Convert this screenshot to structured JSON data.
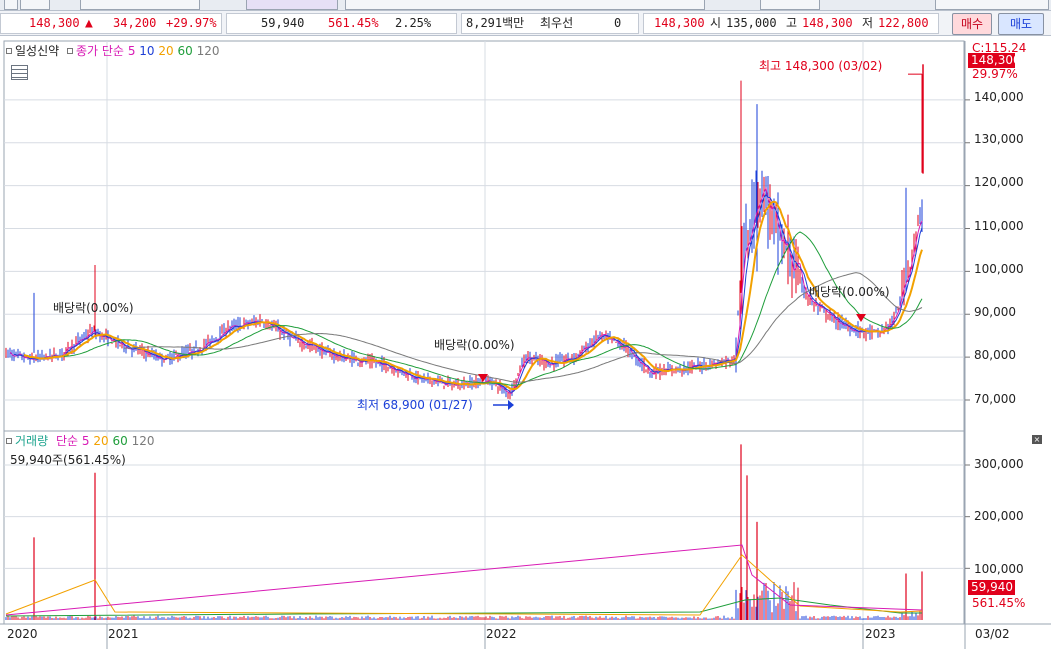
{
  "quote": {
    "price": "148,300",
    "change": "34,200",
    "change_rate": "+29.97%",
    "volume": "59,940",
    "volume_ratio": "561.45%",
    "turnover": "2.25%",
    "amount": "8,291백만",
    "best_label": "최우선",
    "best_qty": "0",
    "best_price": "148,300",
    "open_label": "시",
    "open": "135,000",
    "high_label": "고",
    "high": "148,300",
    "low_label": "저",
    "low": "122,800",
    "buy_label": "매수",
    "sell_label": "매도"
  },
  "price_panel": {
    "item_label": "일성신약",
    "ma_label": "종가 단순",
    "ma_periods": [
      "5",
      "10",
      "20",
      "60",
      "120"
    ],
    "ma_colors": [
      "#d81bb5",
      "#1e3fd6",
      "#f2a100",
      "#1f9e3b",
      "#7a7a7a"
    ],
    "marker_high": "최고 148,300 (03/02)",
    "marker_low": "최저 68,900 (01/27)",
    "dividend_labels": [
      "배당락(0.00%)",
      "배당락(0.00%)",
      "배당락(0.00%)"
    ],
    "price_badge": "148,300",
    "change_badge": "29.97%",
    "cut_label": "C:115.24",
    "y_ticks": [
      "140,000",
      "130,000",
      "120,000",
      "110,000",
      "100,000",
      "90,000",
      "80,000",
      "70,000"
    ]
  },
  "volume_panel": {
    "title": "거래량",
    "ma_label": "단순",
    "ma_periods": [
      "5",
      "20",
      "60",
      "120"
    ],
    "current": "59,940주(561.45%)",
    "badge_value": "59,940",
    "badge_pct": "561.45%",
    "y_ticks": [
      "300,000",
      "200,000",
      "100,000"
    ]
  },
  "x_axis": {
    "labels": [
      "2020",
      "2021",
      "2022",
      "2023"
    ],
    "date_label": "03/02"
  },
  "colors": {
    "up": "#e0001b",
    "down": "#1a3fd8",
    "grid": "#d7dce3"
  }
}
